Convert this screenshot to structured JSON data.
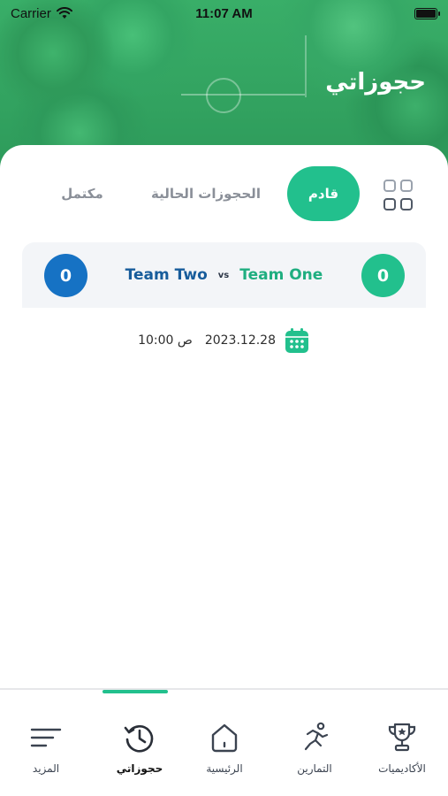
{
  "status_bar": {
    "carrier": "Carrier",
    "time": "11:07 AM",
    "icons": [
      "wifi-icon",
      "battery-icon"
    ]
  },
  "header": {
    "title": "حجوزاتي"
  },
  "tabs": [
    {
      "label": "قادم",
      "active": true
    },
    {
      "label": "الحجوزات الحالية",
      "active": false
    },
    {
      "label": "مكتمل",
      "active": false
    }
  ],
  "booking": {
    "team_one": "Team One",
    "team_two": "Team Two",
    "vs": "vs",
    "score_left": "0",
    "score_right": "0",
    "date": "2023.12.28",
    "time": "10:00 ص"
  },
  "bottom_nav": [
    {
      "label": "المزيد",
      "icon": "menu-lines-icon",
      "active": false
    },
    {
      "label": "حجوزاتي",
      "icon": "history-clock-icon",
      "active": true
    },
    {
      "label": "الرئيسية",
      "icon": "home-icon",
      "active": false
    },
    {
      "label": "التمارين",
      "icon": "running-person-icon",
      "active": false
    },
    {
      "label": "الأكاديميات",
      "icon": "trophy-icon",
      "active": false
    }
  ],
  "colors": {
    "accent": "#22c08d",
    "team_two_blue": "#1672c4",
    "header_green": "#2d9a5a"
  }
}
